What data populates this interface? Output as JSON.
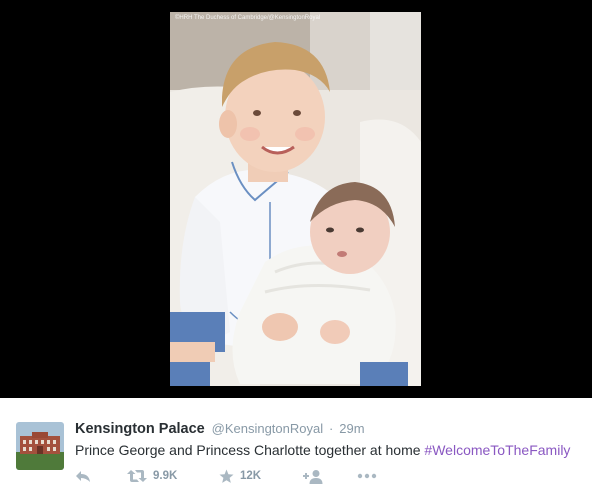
{
  "photo": {
    "credit": "©HRH The Duchess of Cambridge/@KensingtonRoyal"
  },
  "tweet": {
    "display_name": "Kensington Palace",
    "handle": "@KensingtonRoyal",
    "separator": "·",
    "timestamp": "29m",
    "text": "Prince George and Princess Charlotte together at home ",
    "hashtag": "#WelcomeToTheFamily",
    "colors": {
      "hashtag": "#8a58c2",
      "name": "#292f33",
      "meta": "#8899a6",
      "icon": "#aab8c2"
    }
  },
  "actions": {
    "reply": {
      "icon": "reply-icon"
    },
    "retweet": {
      "icon": "retweet-icon",
      "count": "9.9K"
    },
    "favorite": {
      "icon": "star-icon",
      "count": "12K"
    },
    "follow": {
      "icon": "follow-user-icon"
    },
    "more": {
      "icon": "more-dots-icon"
    }
  }
}
